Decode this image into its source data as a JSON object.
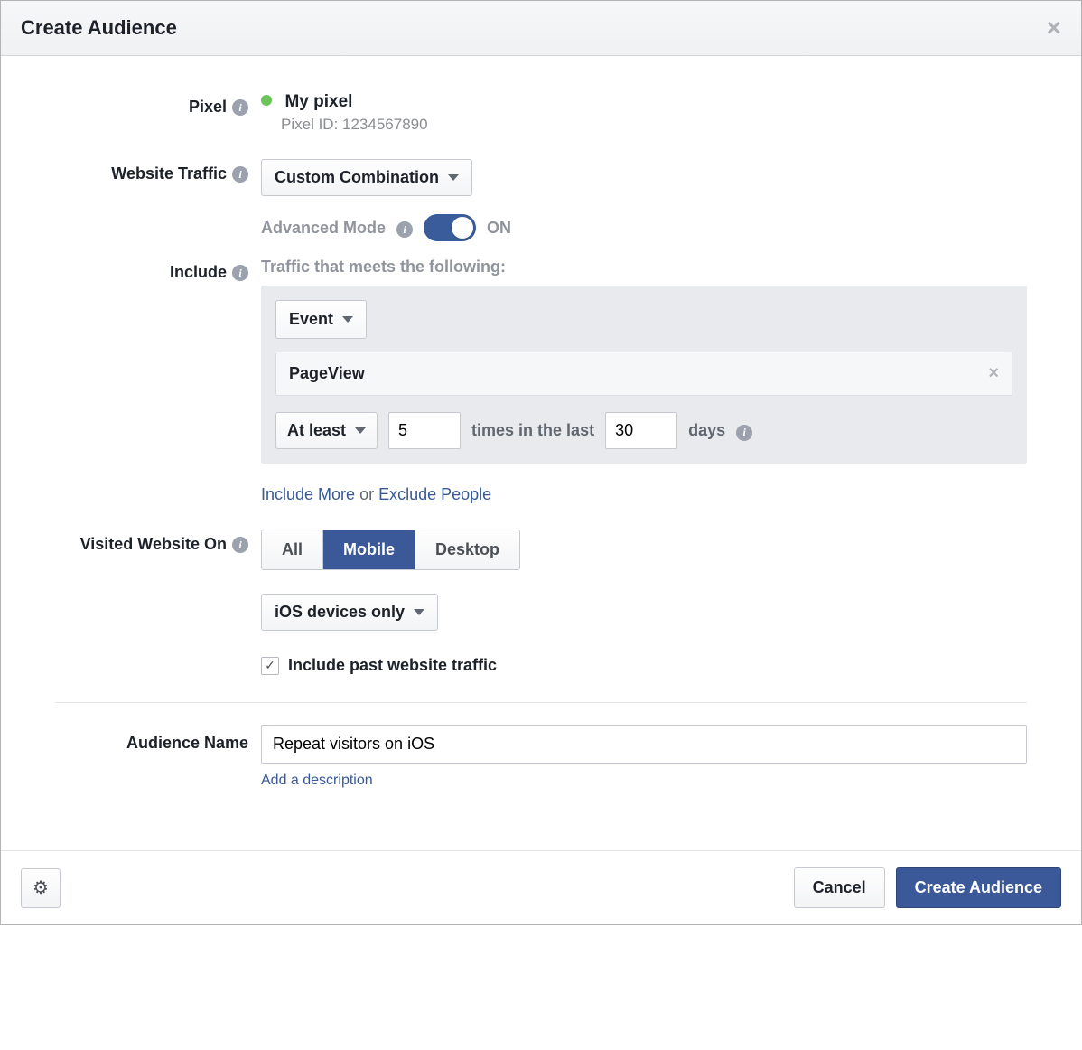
{
  "header": {
    "title": "Create Audience"
  },
  "pixel": {
    "label": "Pixel",
    "name": "My pixel",
    "id_label": "Pixel ID: 1234567890"
  },
  "website_traffic": {
    "label": "Website Traffic",
    "dropdown": "Custom Combination",
    "advanced_label": "Advanced Mode",
    "advanced_state": "ON"
  },
  "include": {
    "label": "Include",
    "subheading": "Traffic that meets the following:",
    "event_dropdown": "Event",
    "event_value": "PageView",
    "frequency_mode": "At least",
    "times_value": "5",
    "times_label": "times in the last",
    "days_value": "30",
    "days_label": "days",
    "include_more": "Include More",
    "or": " or ",
    "exclude_people": "Exclude People"
  },
  "visited": {
    "label": "Visited Website On",
    "segments": [
      "All",
      "Mobile",
      "Desktop"
    ],
    "device_filter": "iOS devices only",
    "past_traffic": "Include past website traffic"
  },
  "audience": {
    "label": "Audience Name",
    "value": "Repeat visitors on iOS",
    "add_description": "Add a description"
  },
  "footer": {
    "cancel": "Cancel",
    "create": "Create Audience"
  }
}
